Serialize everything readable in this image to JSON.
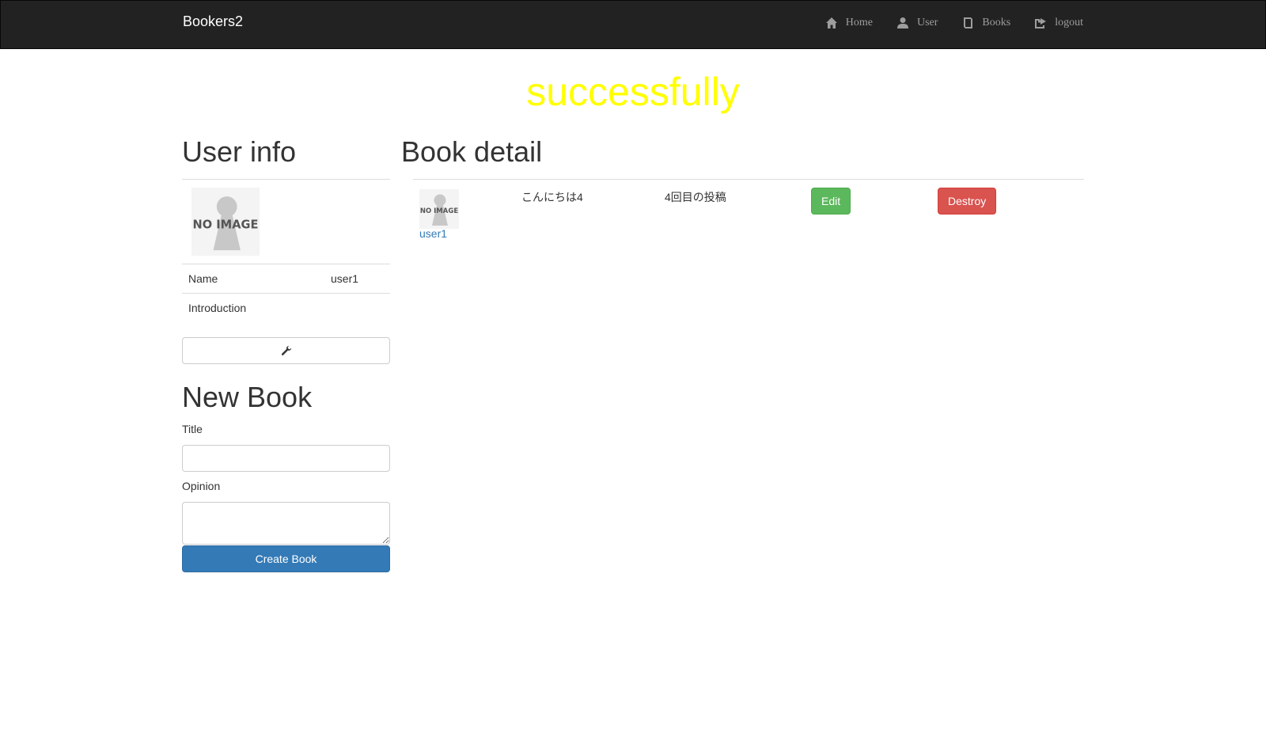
{
  "header": {
    "brand": "Bookers2",
    "nav": [
      {
        "label": "Home",
        "icon": "home-icon"
      },
      {
        "label": "User",
        "icon": "user-icon"
      },
      {
        "label": "Books",
        "icon": "book-icon"
      },
      {
        "label": "logout",
        "icon": "logout-icon"
      }
    ]
  },
  "notice": "successfully",
  "user_info": {
    "title": "User info",
    "image_text": "NO IMAGE",
    "rows": [
      {
        "label": "Name",
        "value": "user1"
      },
      {
        "label": "Introduction",
        "value": ""
      }
    ],
    "edit_icon": "wrench-icon"
  },
  "new_book": {
    "title": "New Book",
    "title_label": "Title",
    "title_value": "",
    "opinion_label": "Opinion",
    "opinion_value": "",
    "submit_label": "Create Book"
  },
  "book_detail": {
    "title": "Book detail",
    "book": {
      "image_text": "NO IMAGE",
      "user_name": "user1",
      "title": "こんにちは4",
      "body": "4回目の投稿",
      "edit_label": "Edit",
      "destroy_label": "Destroy"
    }
  },
  "colors": {
    "navbar_bg": "#222222",
    "notice": "#ffff00",
    "primary": "#337ab7",
    "success": "#5cb85c",
    "danger": "#d9534f"
  }
}
